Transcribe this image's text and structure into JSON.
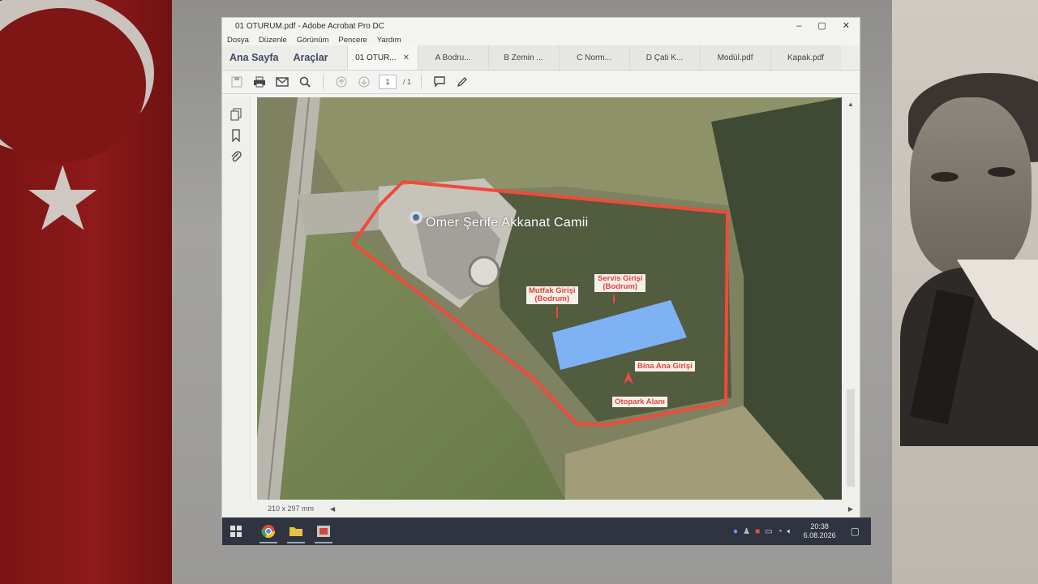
{
  "window": {
    "title": "01 OTURUM.pdf - Adobe Acrobat Pro DC",
    "controls": [
      "–",
      "▢",
      "✕"
    ]
  },
  "menu": [
    "Dosya",
    "Düzenle",
    "Görünüm",
    "Pencere",
    "Yardım"
  ],
  "home_tabs": [
    "Ana Sayfa",
    "Araçlar"
  ],
  "doc_tabs": [
    {
      "label": "01 OTUR...",
      "active": true
    },
    {
      "label": "A Bodru...",
      "active": false
    },
    {
      "label": "B Zemin ...",
      "active": false
    },
    {
      "label": "C Norm...",
      "active": false
    },
    {
      "label": "D Çati K...",
      "active": false
    },
    {
      "label": "Modül.pdf",
      "active": false
    },
    {
      "label": "Kapak.pdf",
      "active": false
    }
  ],
  "toolbar": {
    "page_current": "1",
    "page_total": "/ 1",
    "icons": [
      "save-icon",
      "print-icon",
      "mail-icon",
      "search-icon",
      "prev-page-icon",
      "next-page-icon",
      "comment-icon",
      "pen-icon"
    ]
  },
  "left_rail_icons": [
    "pages-icon",
    "bookmark-icon",
    "attachment-icon"
  ],
  "map": {
    "mosque_label": "Ömer Şerife Akkanat Camii",
    "labels": {
      "kitchen_entrance": [
        "Mutfak Girişi",
        "(Bodrum)"
      ],
      "service_entrance": [
        "Servis Girişi",
        "(Bodrum)"
      ],
      "main_entrance": "Bina Ana Girişi",
      "parking": "Otopark Alanı"
    },
    "colors": {
      "boundary": "#f04a3a",
      "building": "#7fb2f5"
    }
  },
  "status": {
    "page_size": "210 x 297 mm"
  },
  "taskbar": {
    "apps": [
      "windows-start-icon",
      "chrome-icon",
      "file-explorer-icon",
      "acrobat-icon"
    ],
    "time": "20:38",
    "date": "6.08.2026"
  }
}
